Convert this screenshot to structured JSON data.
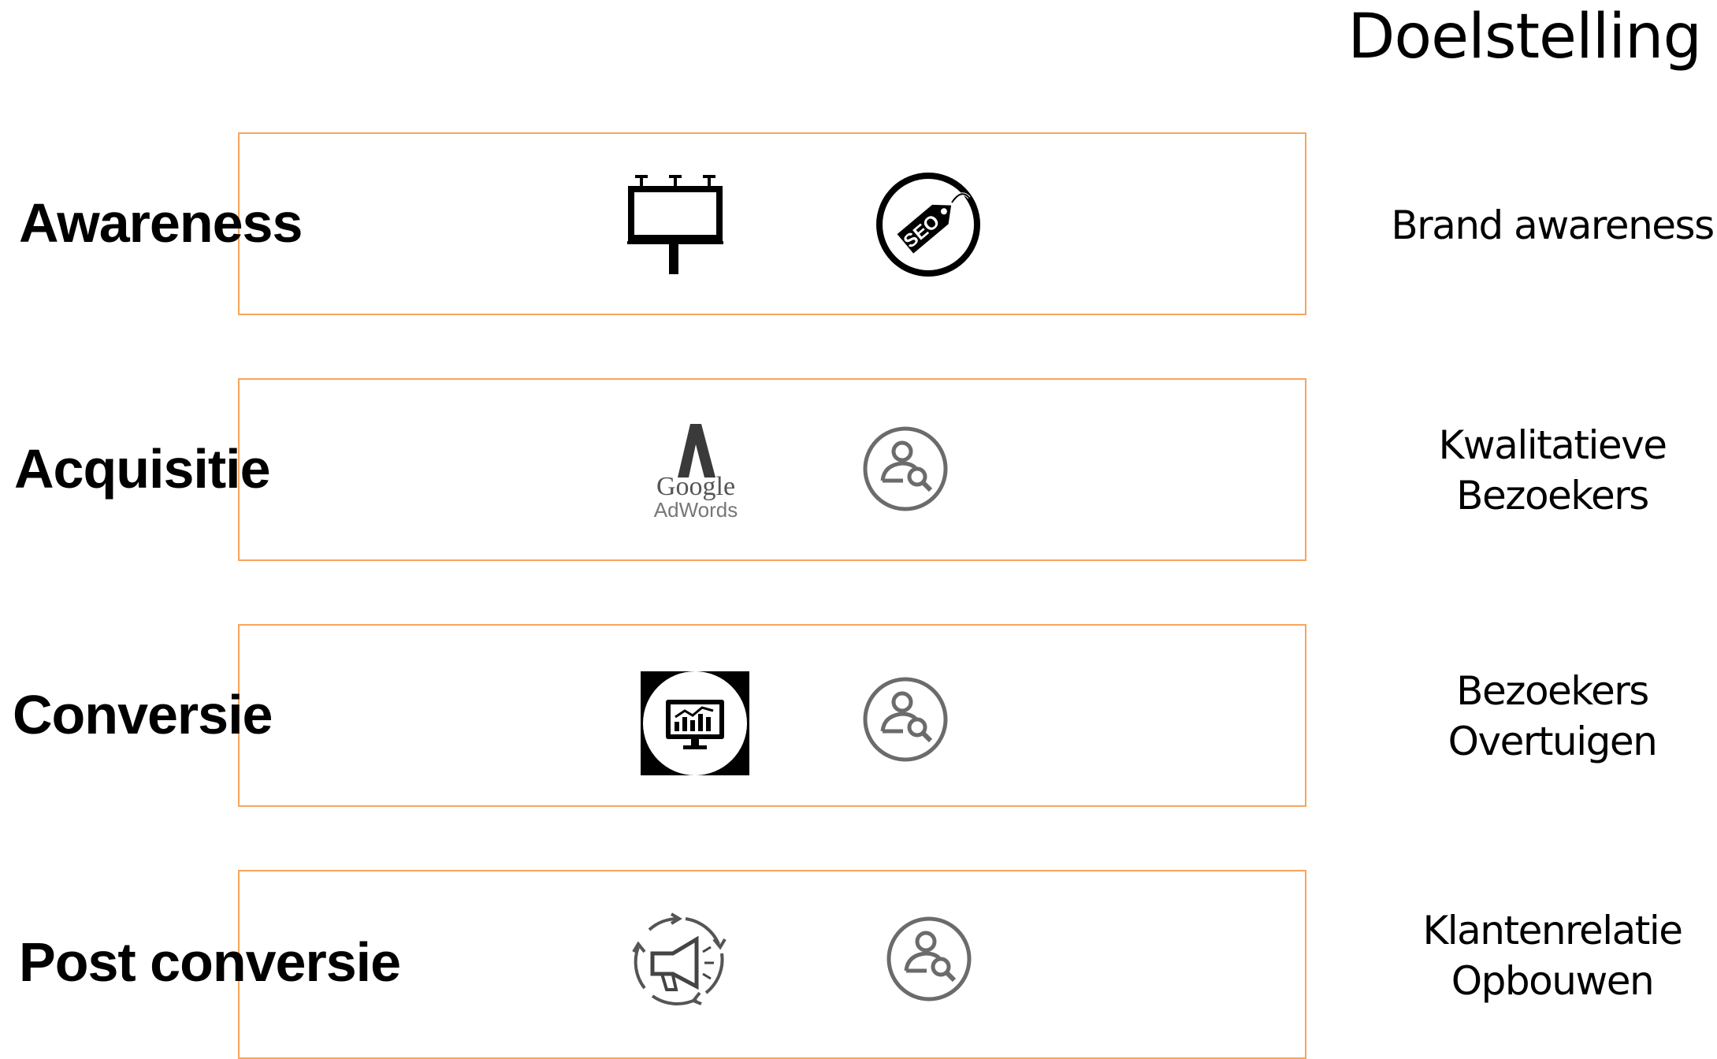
{
  "header": {
    "title": "Doelstelling"
  },
  "rows": [
    {
      "stage": "Awareness",
      "goal_line1": "Brand awareness",
      "goal_line2": "",
      "icons": [
        "billboard-icon",
        "seo-tag-icon"
      ],
      "seo_label": "SEO"
    },
    {
      "stage": "Acquisitie",
      "goal_line1": "Kwalitatieve",
      "goal_line2": "Bezoekers",
      "icons": [
        "google-adwords-icon",
        "user-search-icon"
      ],
      "adwords_line1": "Google",
      "adwords_line2": "AdWords"
    },
    {
      "stage": "Conversie",
      "goal_line1": "Bezoekers",
      "goal_line2": "Overtuigen",
      "icons": [
        "monitor-chart-icon",
        "user-search-icon"
      ]
    },
    {
      "stage": "Post conversie",
      "goal_line1": "Klantenrelatie",
      "goal_line2": "Opbouwen",
      "icons": [
        "megaphone-cycle-icon",
        "user-search-icon"
      ]
    }
  ],
  "colors": {
    "box_border": "#f7a55c",
    "icon_gray": "#6b6b6b"
  }
}
